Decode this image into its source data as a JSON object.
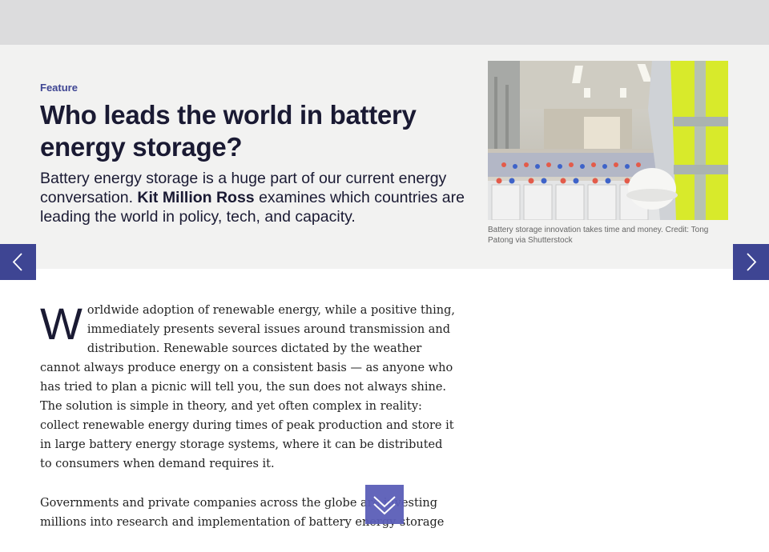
{
  "article": {
    "kicker": "Feature",
    "title": "Who leads the world in battery energy storage?",
    "standfirst": {
      "before": "Battery energy storage is a huge part of our current energy conversation. ",
      "author": "Kit Million Ross",
      "after": " examines which countries are leading the world in policy, tech, and capacity."
    },
    "image": {
      "caption": "Battery storage innovation takes time and money. Credit: Tong Patong via Shutterstock"
    },
    "body": {
      "dropcap": "W",
      "paragraph1": "orldwide adoption of renewable energy, while a positive thing, immediately presents several issues around transmission and distribution. Renewable sources dictated by the weather cannot always produce energy on a consistent basis — as anyone who has tried to plan a picnic will tell you, the sun does not always shine. The solution is simple in theory, and yet often complex in reality: collect renewable energy during times of peak production and store it in large battery energy storage systems, where it can be distributed to consumers when demand requires it.",
      "paragraph2": "Governments and private companies across the globe are investing millions into research and implementation of battery energy storage"
    }
  },
  "controls": {
    "prev_icon": "chevron-left-icon",
    "next_icon": "chevron-right-icon",
    "scroll_icon": "double-chevron-down-icon"
  },
  "colors": {
    "accent": "#3e4593",
    "scroll_button": "#5b5eb8",
    "hero_bg": "#f2f2f1",
    "topbar_bg": "#dcdcdd",
    "headline": "#1a1a33"
  }
}
